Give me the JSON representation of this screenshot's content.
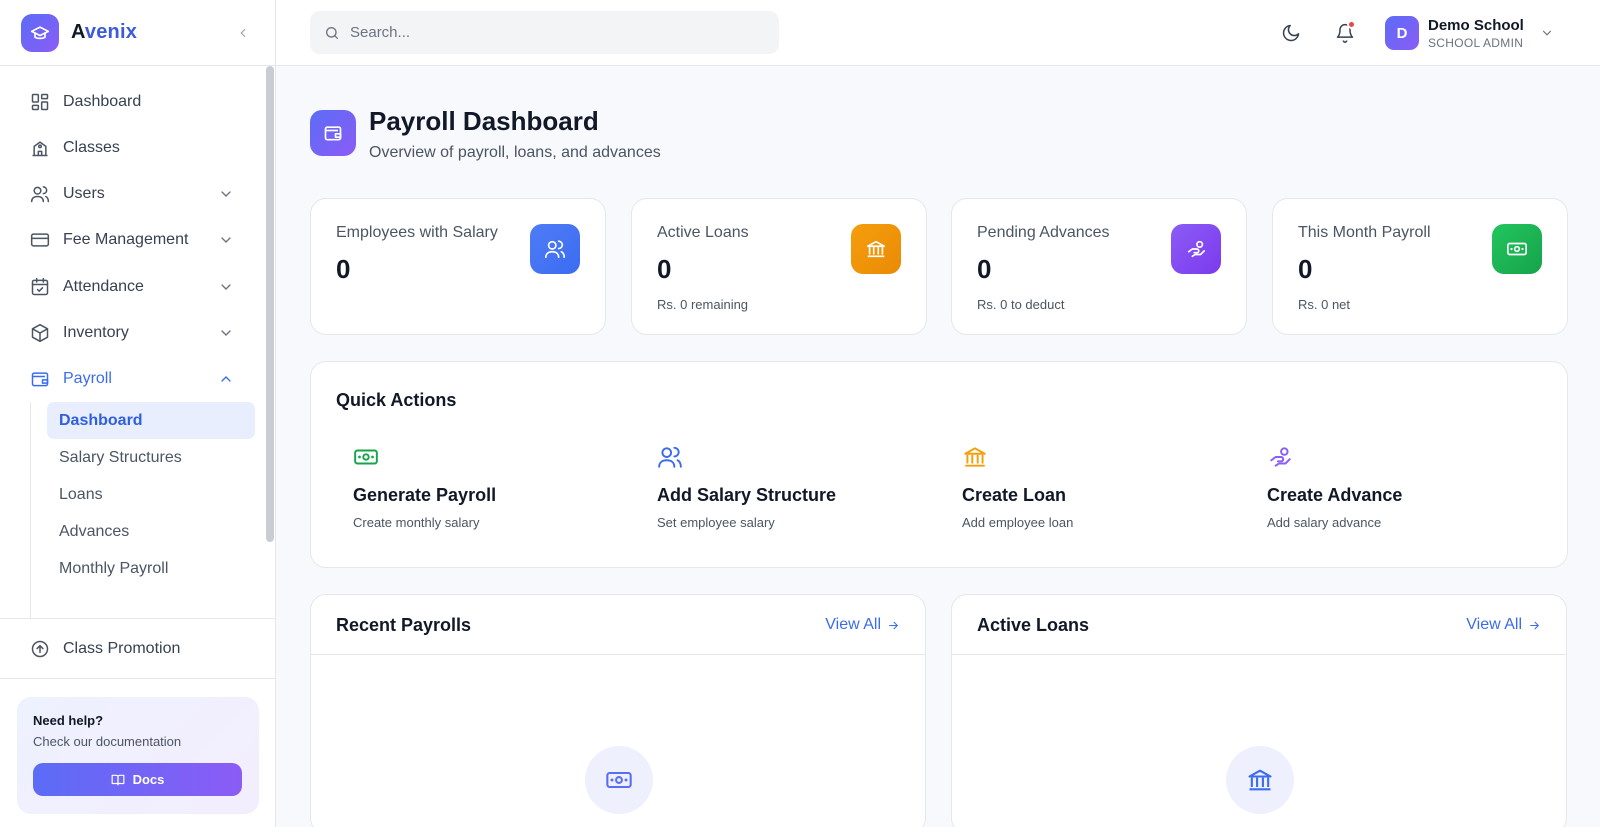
{
  "brand": {
    "first_letter": "A",
    "rest": "venix"
  },
  "sidebar": {
    "items": [
      {
        "label": "Dashboard",
        "icon": "dashboard-icon"
      },
      {
        "label": "Classes",
        "icon": "school-icon"
      },
      {
        "label": "Users",
        "icon": "users-icon"
      },
      {
        "label": "Fee Management",
        "icon": "credit-card-icon"
      },
      {
        "label": "Attendance",
        "icon": "calendar-check-icon"
      },
      {
        "label": "Inventory",
        "icon": "box-icon"
      },
      {
        "label": "Payroll",
        "icon": "wallet-icon"
      }
    ],
    "payroll_sub": [
      "Dashboard",
      "Salary Structures",
      "Loans",
      "Advances",
      "Monthly Payroll"
    ],
    "bottom_item": "Class Promotion"
  },
  "help": {
    "title": "Need help?",
    "subtitle": "Check our documentation",
    "button": "Docs"
  },
  "search": {
    "placeholder": "Search..."
  },
  "user": {
    "initial": "D",
    "name": "Demo School",
    "role": "SCHOOL ADMIN"
  },
  "page": {
    "title": "Payroll Dashboard",
    "subtitle": "Overview of payroll, loans, and advances"
  },
  "stats": [
    {
      "label": "Employees with Salary",
      "value": "0",
      "sub": "",
      "color": "#4f7cf7",
      "icon": "users-icon"
    },
    {
      "label": "Active Loans",
      "value": "0",
      "sub": "Rs. 0 remaining",
      "color": "#f59e0b",
      "icon": "bank-icon"
    },
    {
      "label": "Pending Advances",
      "value": "0",
      "sub": "Rs. 0 to deduct",
      "color": "#8b5cf6",
      "icon": "hand-coins-icon"
    },
    {
      "label": "This Month Payroll",
      "value": "0",
      "sub": "Rs. 0 net",
      "color": "#22c55e",
      "icon": "banknote-icon"
    }
  ],
  "quick_actions": {
    "title": "Quick Actions",
    "items": [
      {
        "name": "Generate Payroll",
        "desc": "Create monthly salary",
        "icon": "banknote-icon",
        "color": "#16a34a"
      },
      {
        "name": "Add Salary Structure",
        "desc": "Set employee salary",
        "icon": "users-icon",
        "color": "#3b6cf0"
      },
      {
        "name": "Create Loan",
        "desc": "Add employee loan",
        "icon": "bank-icon",
        "color": "#f59e0b"
      },
      {
        "name": "Create Advance",
        "desc": "Add salary advance",
        "icon": "hand-coins-icon",
        "color": "#8b5cf6"
      }
    ]
  },
  "panels": [
    {
      "title": "Recent Payrolls",
      "link": "View All",
      "empty_icon": "banknote-icon"
    },
    {
      "title": "Active Loans",
      "link": "View All",
      "empty_icon": "bank-icon"
    }
  ]
}
